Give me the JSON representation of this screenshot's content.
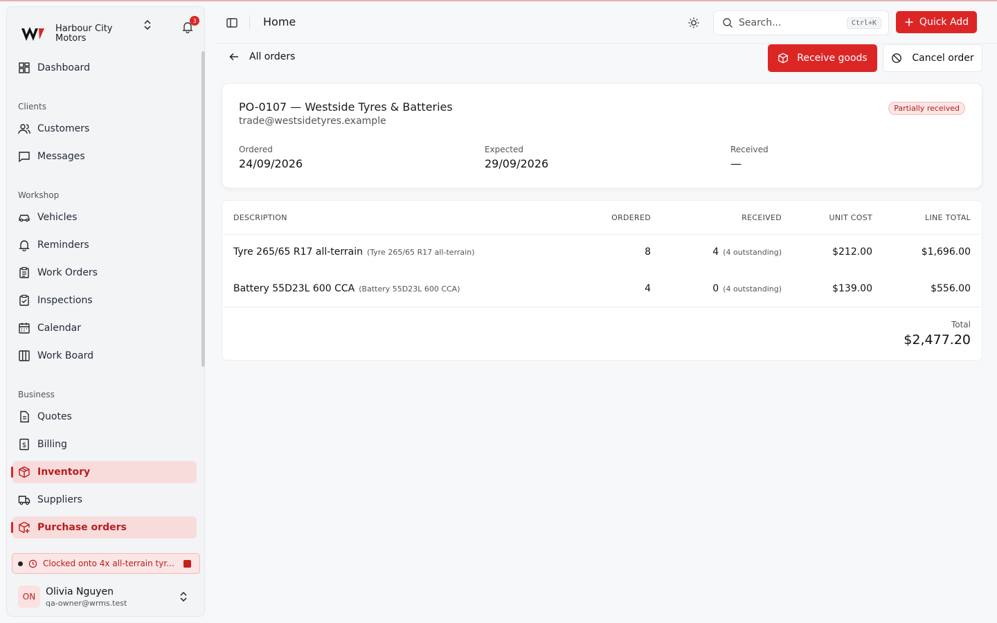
{
  "app": {
    "brand_name": "Harbour City Motors",
    "notification_count": "3",
    "accent_color": "#dc2626"
  },
  "sidebar": {
    "top_item": "Dashboard",
    "groups": [
      {
        "title": "Clients",
        "items": [
          "Customers",
          "Messages"
        ]
      },
      {
        "title": "Workshop",
        "items": [
          "Vehicles",
          "Reminders",
          "Work Orders",
          "Inspections",
          "Calendar",
          "Work Board"
        ]
      },
      {
        "title": "Business",
        "items": [
          "Quotes",
          "Billing",
          "Inventory",
          "Suppliers",
          "Purchase orders"
        ]
      }
    ],
    "clock_text": "Clocked onto 4x all-terrain tyr...",
    "user": {
      "initials": "ON",
      "name": "Olivia Nguyen",
      "email": "qa-owner@wrms.test"
    }
  },
  "topbar": {
    "title": "Home",
    "search_placeholder": "Search...",
    "search_shortcut": "Ctrl+K",
    "quick_add": "Quick Add"
  },
  "actions": {
    "back": "All orders",
    "receive": "Receive goods",
    "cancel": "Cancel order"
  },
  "po": {
    "title": "PO-0107 — Westside Tyres & Batteries",
    "email": "trade@westsidetyres.example",
    "status": "Partially received",
    "ordered_label": "Ordered",
    "ordered_value": "24/09/2026",
    "expected_label": "Expected",
    "expected_value": "29/09/2026",
    "received_label": "Received",
    "received_value": "—"
  },
  "table": {
    "headers": [
      "DESCRIPTION",
      "ORDERED",
      "RECEIVED",
      "UNIT COST",
      "LINE TOTAL"
    ],
    "rows": [
      {
        "desc": "Tyre 265/65 R17 all-terrain",
        "sub": "(Tyre 265/65 R17 all-terrain)",
        "ordered": "8",
        "received": "4",
        "outstanding": "(4 outstanding)",
        "unit": "$212.00",
        "total": "$1,696.00"
      },
      {
        "desc": "Battery 55D23L 600 CCA",
        "sub": "(Battery 55D23L 600 CCA)",
        "ordered": "4",
        "received": "0",
        "outstanding": "(4 outstanding)",
        "unit": "$139.00",
        "total": "$556.00"
      }
    ],
    "total_label": "Total",
    "total_value": "$2,477.20"
  }
}
